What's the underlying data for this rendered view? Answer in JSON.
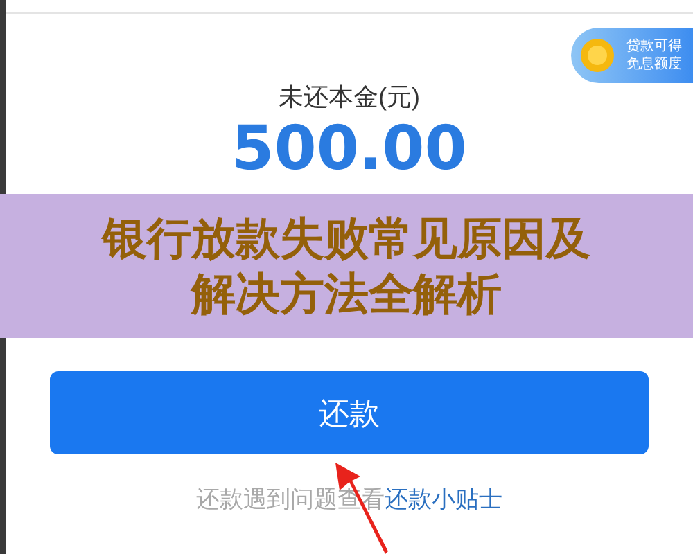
{
  "badge": {
    "lines": [
      "贷款可得",
      "免息额度"
    ]
  },
  "summary": {
    "label": "未还本金(元)",
    "amount": "500.00"
  },
  "overlay_title": {
    "lines": [
      "银行放款失败常见原因及",
      "解决方法全解析"
    ]
  },
  "repay_button": {
    "label": "还款"
  },
  "help": {
    "text": "还款遇到问题查看",
    "link": "还款小贴士"
  }
}
